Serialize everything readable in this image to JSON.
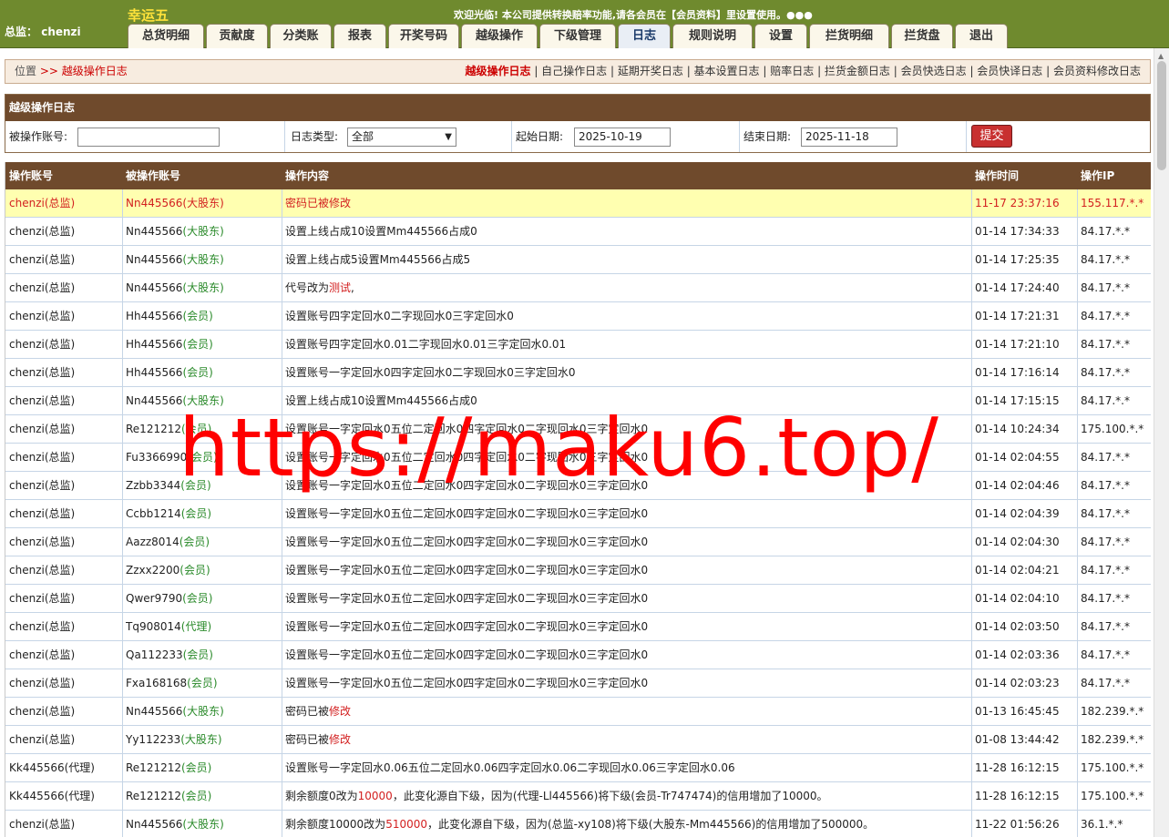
{
  "header": {
    "brand": "幸运五",
    "welcome": "欢迎光临! 本公司提供转换赔率功能,请各会员在【会员资料】里设置使用。●●●",
    "account_label": "总监：",
    "account_name": "chenzi"
  },
  "nav": {
    "tabs": [
      "总货明细",
      "贡献度",
      "分类账",
      "报表",
      "开奖号码",
      "越级操作",
      "下级管理",
      "日志",
      "规则说明",
      "设置",
      "拦货明细",
      "拦货盘",
      "退出"
    ],
    "active": "日志"
  },
  "breadcrumb": {
    "pos": "位置",
    "sep": ">>",
    "current": "越级操作日志"
  },
  "log_links": [
    "越级操作日志",
    "自己操作日志",
    "延期开奖日志",
    "基本设置日志",
    "赔率日志",
    "拦货金额日志",
    "会员快选日志",
    "会员快译日志",
    "会员资料修改日志"
  ],
  "filter": {
    "title": "越级操作日志",
    "operated_label": "被操作账号:",
    "operated_value": "",
    "type_label": "日志类型:",
    "type_value": "全部",
    "start_label": "起始日期:",
    "start_value": "2025-10-19",
    "end_label": "结束日期:",
    "end_value": "2025-11-18",
    "submit": "提交"
  },
  "table": {
    "headers": [
      "操作账号",
      "被操作账号",
      "操作内容",
      "操作时间",
      "操作IP"
    ],
    "rows": [
      {
        "op": "chenzi(总监)",
        "target": "Nn445566",
        "role": "(大股东)",
        "content": "密码已被修改",
        "time": "11-17 23:37:16",
        "ip": "155.117.*.*",
        "hl": true
      },
      {
        "op": "chenzi(总监)",
        "target": "Nn445566",
        "role": "(大股东)",
        "content": "设置上线占成10设置Mm445566占成0",
        "time": "01-14 17:34:33",
        "ip": "84.17.*.*"
      },
      {
        "op": "chenzi(总监)",
        "target": "Nn445566",
        "role": "(大股东)",
        "content": "设置上线占成5设置Mm445566占成5",
        "time": "01-14 17:25:35",
        "ip": "84.17.*.*"
      },
      {
        "op": "chenzi(总监)",
        "target": "Nn445566",
        "role": "(大股东)",
        "content": "代号改为",
        "content_red": "测试",
        "content_tail": ",",
        "time": "01-14 17:24:40",
        "ip": "84.17.*.*"
      },
      {
        "op": "chenzi(总监)",
        "target": "Hh445566",
        "role": "(会员)",
        "content": "设置账号四字定回水0二字现回水0三字定回水0",
        "time": "01-14 17:21:31",
        "ip": "84.17.*.*"
      },
      {
        "op": "chenzi(总监)",
        "target": "Hh445566",
        "role": "(会员)",
        "content": "设置账号四字定回水0.01二字现回水0.01三字定回水0.01",
        "time": "01-14 17:21:10",
        "ip": "84.17.*.*"
      },
      {
        "op": "chenzi(总监)",
        "target": "Hh445566",
        "role": "(会员)",
        "content": "设置账号一字定回水0四字定回水0二字现回水0三字定回水0",
        "time": "01-14 17:16:14",
        "ip": "84.17.*.*"
      },
      {
        "op": "chenzi(总监)",
        "target": "Nn445566",
        "role": "(大股东)",
        "content": "设置上线占成10设置Mm445566占成0",
        "time": "01-14 17:15:15",
        "ip": "84.17.*.*"
      },
      {
        "op": "chenzi(总监)",
        "target": "Re121212",
        "role": "(会员)",
        "content": "设置账号一字定回水0五位二定回水0四字定回水0二字现回水0三字定回水0",
        "time": "01-14 10:24:34",
        "ip": "175.100.*.*"
      },
      {
        "op": "chenzi(总监)",
        "target": "Fu3366990",
        "role": "(会员)",
        "content": "设置账号一字定回水0五位二定回水0四字定回水0二字现回水0三字定回水0",
        "time": "01-14 02:04:55",
        "ip": "84.17.*.*"
      },
      {
        "op": "chenzi(总监)",
        "target": "Zzbb3344",
        "role": "(会员)",
        "content": "设置账号一字定回水0五位二定回水0四字定回水0二字现回水0三字定回水0",
        "time": "01-14 02:04:46",
        "ip": "84.17.*.*"
      },
      {
        "op": "chenzi(总监)",
        "target": "Ccbb1214",
        "role": "(会员)",
        "content": "设置账号一字定回水0五位二定回水0四字定回水0二字现回水0三字定回水0",
        "time": "01-14 02:04:39",
        "ip": "84.17.*.*"
      },
      {
        "op": "chenzi(总监)",
        "target": "Aazz8014",
        "role": "(会员)",
        "content": "设置账号一字定回水0五位二定回水0四字定回水0二字现回水0三字定回水0",
        "time": "01-14 02:04:30",
        "ip": "84.17.*.*"
      },
      {
        "op": "chenzi(总监)",
        "target": "Zzxx2200",
        "role": "(会员)",
        "content": "设置账号一字定回水0五位二定回水0四字定回水0二字现回水0三字定回水0",
        "time": "01-14 02:04:21",
        "ip": "84.17.*.*"
      },
      {
        "op": "chenzi(总监)",
        "target": "Qwer9790",
        "role": "(会员)",
        "content": "设置账号一字定回水0五位二定回水0四字定回水0二字现回水0三字定回水0",
        "time": "01-14 02:04:10",
        "ip": "84.17.*.*"
      },
      {
        "op": "chenzi(总监)",
        "target": "Tq908014",
        "role": "(代理)",
        "content": "设置账号一字定回水0五位二定回水0四字定回水0二字现回水0三字定回水0",
        "time": "01-14 02:03:50",
        "ip": "84.17.*.*"
      },
      {
        "op": "chenzi(总监)",
        "target": "Qa112233",
        "role": "(会员)",
        "content": "设置账号一字定回水0五位二定回水0四字定回水0二字现回水0三字定回水0",
        "time": "01-14 02:03:36",
        "ip": "84.17.*.*"
      },
      {
        "op": "chenzi(总监)",
        "target": "Fxa168168",
        "role": "(会员)",
        "content": "设置账号一字定回水0五位二定回水0四字定回水0二字现回水0三字定回水0",
        "time": "01-14 02:03:23",
        "ip": "84.17.*.*"
      },
      {
        "op": "chenzi(总监)",
        "target": "Nn445566",
        "role": "(大股东)",
        "content": "密码已被",
        "content_red": "修改",
        "content_tail": "",
        "time": "01-13 16:45:45",
        "ip": "182.239.*.*"
      },
      {
        "op": "chenzi(总监)",
        "target": "Yy112233",
        "role": "(大股东)",
        "content": "密码已被",
        "content_red": "修改",
        "content_tail": "",
        "time": "01-08 13:44:42",
        "ip": "182.239.*.*"
      },
      {
        "op": "Kk445566(代理)",
        "target": "Re121212",
        "role": "(会员)",
        "content": "设置账号一字定回水0.06五位二定回水0.06四字定回水0.06二字现回水0.06三字定回水0.06",
        "time": "11-28 16:12:15",
        "ip": "175.100.*.*"
      },
      {
        "op": "Kk445566(代理)",
        "target": "Re121212",
        "role": "(会员)",
        "content": "剩余额度0改为",
        "content_red": "10000",
        "content_tail": "，此变化源自下级，因为(代理-Ll445566)将下级(会员-Tr747474)的信用增加了10000。",
        "time": "11-28 16:12:15",
        "ip": "175.100.*.*"
      },
      {
        "op": "chenzi(总监)",
        "target": "Nn445566",
        "role": "(大股东)",
        "content": "剩余额度10000改为",
        "content_red": "510000",
        "content_tail": "，此变化源自下级，因为(总监-xy108)将下级(大股东-Mm445566)的信用增加了500000。",
        "time": "11-22 01:56:26",
        "ip": "36.1.*.*"
      }
    ]
  },
  "watermark": "https://maku6.top/",
  "colors": {
    "top_bar": "#6f8a2e",
    "table_header": "#6f4a2c",
    "highlight_row": "#ffffb0",
    "role_text": "#2a8a2a",
    "alert_text": "#d32020"
  }
}
